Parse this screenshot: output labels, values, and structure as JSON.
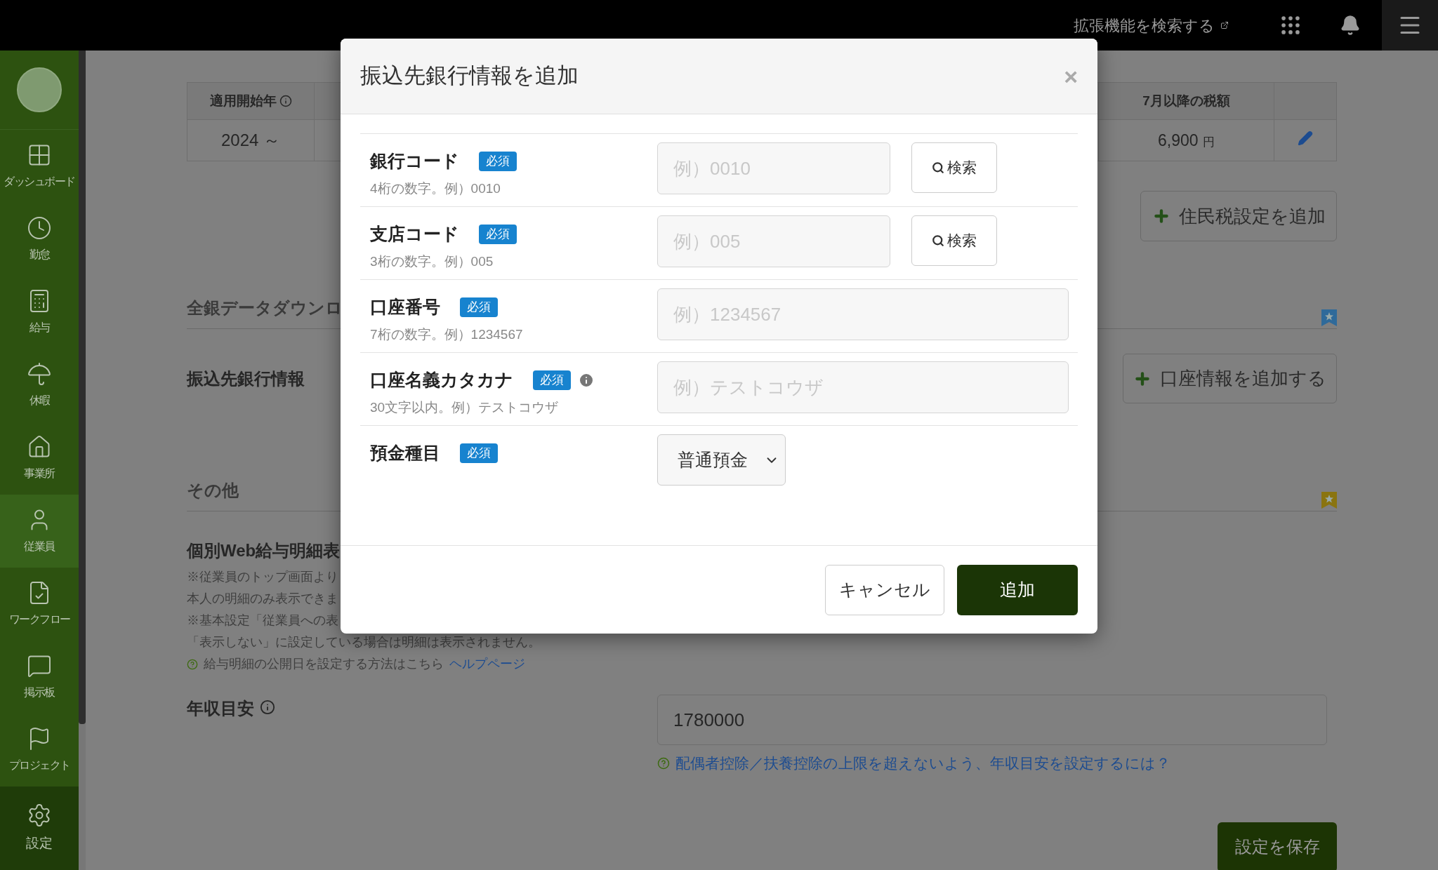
{
  "top_bar": {
    "extension_search": "拡張機能を検索する"
  },
  "sidebar": {
    "items": [
      {
        "label": "ダッシュボード",
        "selected": false
      },
      {
        "label": "勤怠",
        "selected": false
      },
      {
        "label": "給与",
        "selected": false
      },
      {
        "label": "休暇",
        "selected": false
      },
      {
        "label": "事業所",
        "selected": false
      },
      {
        "label": "従業員",
        "selected": true
      },
      {
        "label": "ワークフロー",
        "selected": false
      },
      {
        "label": "掲示板",
        "selected": false
      },
      {
        "label": "プロジェクト",
        "selected": false
      }
    ],
    "settings": {
      "label": "設定"
    }
  },
  "tax_table": {
    "columns": [
      {
        "label": "適用開始年"
      },
      {
        "label": "7月以降の税額"
      }
    ],
    "row": {
      "start": "2024 ～",
      "tax": "6,900",
      "unit": "円"
    }
  },
  "add_resident_tax_button": "住民税設定を追加",
  "sections": [
    {
      "title": "全銀データダウンロ"
    },
    {
      "title": "その他"
    }
  ],
  "bank_info": {
    "label": "振込先銀行情報",
    "add_button": "口座情報を追加する"
  },
  "web_payslip": {
    "title": "個別Web給与明細表",
    "notes": [
      "※従業員のトップ画面より",
      "本人の明細のみ表示できま",
      "※基本設定「従業員への表",
      "「表示しない」に設定している場合は明細は表示されません。"
    ],
    "help_text": "給与明細の公開日を設定する方法はこちら",
    "help_link": "ヘルプページ"
  },
  "annual_income": {
    "label": "年収目安",
    "value": "1780000",
    "help_link": "配偶者控除／扶養控除の上限を超えないよう、年収目安を設定するには？"
  },
  "save_button": "設定を保存",
  "modal": {
    "title": "振込先銀行情報を追加",
    "close": "×",
    "rows": [
      {
        "label": "銀行コード",
        "required": "必須",
        "info": false,
        "hint": "4桁の数字。例）0010",
        "field": {
          "kind": "short",
          "placeholder": "例）0010",
          "search_button": "検索"
        }
      },
      {
        "label": "支店コード",
        "required": "必須",
        "info": false,
        "hint": "3桁の数字。例）005",
        "field": {
          "kind": "short",
          "placeholder": "例）005",
          "search_button": "検索"
        }
      },
      {
        "label": "口座番号",
        "required": "必須",
        "info": false,
        "hint": "7桁の数字。例）1234567",
        "field": {
          "kind": "wide",
          "placeholder": "例）1234567"
        }
      },
      {
        "label": "口座名義カタカナ",
        "required": "必須",
        "info": true,
        "hint": "30文字以内。例）テストコウザ",
        "field": {
          "kind": "wide",
          "placeholder": "例）テストコウザ"
        }
      },
      {
        "label": "預金種目",
        "required": "必須",
        "info": false,
        "field": {
          "kind": "select",
          "value": "普通預金"
        }
      }
    ],
    "cancel_button": "キャンセル",
    "add_button": "追加"
  }
}
